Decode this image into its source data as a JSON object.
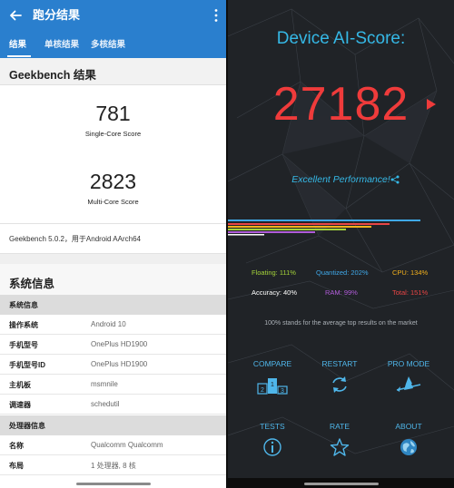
{
  "left": {
    "app_title": "跑分结果",
    "tabs": [
      {
        "label": "结果"
      },
      {
        "label": "单核结果"
      },
      {
        "label": "多核结果"
      }
    ],
    "geekbench_title": "Geekbench 结果",
    "single_core": {
      "value": "781",
      "label": "Single-Core Score"
    },
    "multi_core": {
      "value": "2823",
      "label": "Multi-Core Score"
    },
    "version_text": "Geekbench 5.0.2，用于Android AArch64",
    "system_title": "系统信息",
    "sections": [
      {
        "title": "系统信息",
        "rows": [
          {
            "key": "操作系统",
            "value": "Android 10"
          },
          {
            "key": "手机型号",
            "value": "OnePlus HD1900"
          },
          {
            "key": "手机型号ID",
            "value": "OnePlus HD1900"
          },
          {
            "key": "主机板",
            "value": "msmnile"
          },
          {
            "key": "调速器",
            "value": "schedutil"
          }
        ]
      },
      {
        "title": "处理器信息",
        "rows": [
          {
            "key": "名称",
            "value": "Qualcomm Qualcomm"
          },
          {
            "key": "布局",
            "value": "1 处理器, 8 核"
          }
        ]
      }
    ]
  },
  "right": {
    "title": "Device AI-Score:",
    "score": "27182",
    "performance": "Excellent Performance!",
    "metrics": [
      {
        "label": "Floating: 111%",
        "color": "#a4d23a"
      },
      {
        "label": "Quantized: 202%",
        "color": "#3fa9ea"
      },
      {
        "label": "CPU: 134%",
        "color": "#f5b21c"
      },
      {
        "label": "Accuracy: 40%",
        "color": "#ffffff"
      },
      {
        "label": "RAM: 99%",
        "color": "#b05cd8"
      },
      {
        "label": "Total: 151%",
        "color": "#e94545"
      }
    ],
    "note": "100% stands for the average top results on the market",
    "actions": [
      {
        "label": "COMPARE",
        "icon": "podium-icon"
      },
      {
        "label": "RESTART",
        "icon": "restart-icon"
      },
      {
        "label": "PRO MODE",
        "icon": "witch-icon"
      },
      {
        "label": "TESTS",
        "icon": "info-icon"
      },
      {
        "label": "RATE",
        "icon": "star-icon"
      },
      {
        "label": "ABOUT",
        "icon": "globe-icon"
      }
    ]
  },
  "colors": {
    "app_bar": "#2a7fce",
    "accent_blue": "#35b8e6",
    "score_red": "#ef3b3b"
  }
}
